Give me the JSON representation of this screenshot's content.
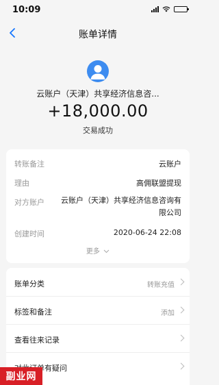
{
  "status_bar": {
    "time": "10:09"
  },
  "nav": {
    "title": "账单详情"
  },
  "header": {
    "counterparty": "云账户（天津）共享经济信息咨...",
    "amount": "+18,000.00",
    "status": "交易成功"
  },
  "details": {
    "rows": [
      {
        "label": "转账备注",
        "value": "云账户"
      },
      {
        "label": "理由",
        "value": "高佣联盟提现"
      },
      {
        "label": "对方账户",
        "value": "云账户（天津）共享经济信息咨询有限公司"
      },
      {
        "label": "创建时间",
        "value": "2020-06-24 22:08"
      }
    ],
    "more": "更多"
  },
  "actions": [
    {
      "label": "账单分类",
      "value": "转账充值"
    },
    {
      "label": "标签和备注",
      "value": "添加"
    },
    {
      "label": "查看往来记录",
      "value": ""
    },
    {
      "label": "对此订单有疑问",
      "value": ""
    }
  ],
  "watermark": "副业网",
  "colors": {
    "accent": "#1677ff",
    "avatar": "#3d8cf0",
    "watermark_bg": "#d81f26"
  }
}
